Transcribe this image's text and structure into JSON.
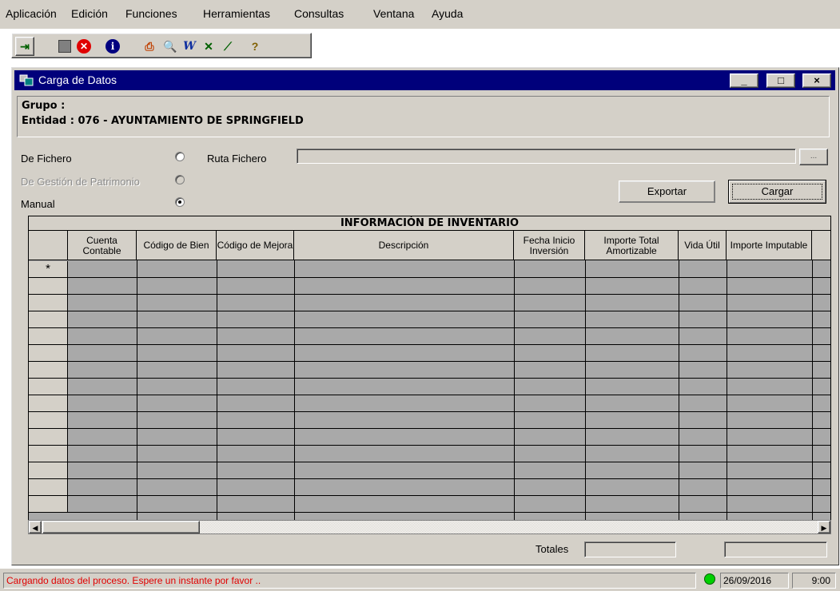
{
  "menu": [
    {
      "label": "Aplicación"
    },
    {
      "label": "Edición"
    },
    {
      "label": "Funciones"
    },
    {
      "label": "Herramientas"
    },
    {
      "label": "Consultas"
    },
    {
      "label": "Ventana"
    },
    {
      "label": "Ayuda"
    }
  ],
  "toolbar": {
    "icons": [
      "exit-icon",
      "stop-icon",
      "cancel-icon",
      "info-icon",
      "print-icon",
      "search-icon",
      "word-icon",
      "excel-icon",
      "chart-icon",
      "help-icon"
    ]
  },
  "window": {
    "title": "Carga de Datos",
    "minimize": "_",
    "maximize": "□",
    "close": "×"
  },
  "header": {
    "grupo": "Grupo :",
    "entidad": "Entidad : 076 - AYUNTAMIENTO DE SPRINGFIELD"
  },
  "source": {
    "de_fichero": "De Fichero",
    "de_gestion": "De Gestión de Patrimonio",
    "manual": "Manual",
    "selected": "Manual",
    "ruta_label": "Ruta Fichero",
    "ruta_value": "",
    "browse": "..."
  },
  "buttons": {
    "exportar": "Exportar",
    "cargar": "Cargar"
  },
  "grid": {
    "title": "INFORMACIÓN DE INVENTARIO",
    "columns": [
      {
        "label": "Cuenta Contable"
      },
      {
        "label": "Código de Bien"
      },
      {
        "label": "Código de Mejora"
      },
      {
        "label": "Descripción"
      },
      {
        "label": "Fecha Inicio Inversión"
      },
      {
        "label": "Importe Total Amortizable"
      },
      {
        "label": "Vida Útil"
      },
      {
        "label": "Importe Imputable"
      }
    ],
    "new_row_marker": "*"
  },
  "totales": {
    "label": "Totales",
    "value1": "",
    "value2": ""
  },
  "status": {
    "message": "Cargando datos del proceso. Espere un instante por favor ..",
    "date": "26/09/2016",
    "time": "9:00",
    "message_color": "#e00000",
    "led_color": "#00d000"
  }
}
